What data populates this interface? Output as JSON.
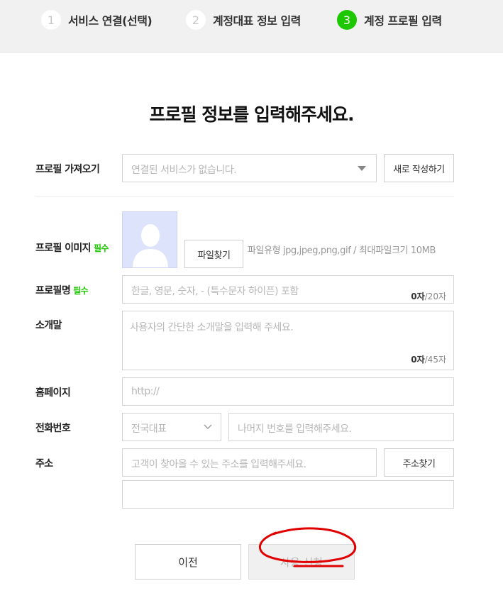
{
  "steps": [
    {
      "num": "1",
      "label": "서비스 연결(선택)"
    },
    {
      "num": "2",
      "label": "계정대표 정보 입력"
    },
    {
      "num": "3",
      "label": "계정 프로필 입력"
    }
  ],
  "page_title": "프로필 정보를 입력해주세요.",
  "colors": {
    "accent": "#1ec800",
    "annotation": "#e00000"
  },
  "profile_import": {
    "label": "프로필 가져오기",
    "select_placeholder": "연결된 서비스가 없습니다.",
    "new_button": "새로 작성하기"
  },
  "profile_image": {
    "label": "프로필 이미지",
    "required": "필수",
    "file_button": "파일찾기",
    "file_info": "파일유형 jpg,jpeg,png,gif / 최대파일크기 10MB"
  },
  "profile_name": {
    "label": "프로필명",
    "required": "필수",
    "placeholder": "한글, 영문, 숫자, - (특수문자 하이픈) 포함",
    "count": "0자",
    "max": "/20자"
  },
  "intro": {
    "label": "소개말",
    "placeholder": "사용자의 간단한 소개말을 입력해 주세요.",
    "count": "0자",
    "max": "/45자"
  },
  "homepage": {
    "label": "홈페이지",
    "placeholder": "http://"
  },
  "phone": {
    "label": "전화번호",
    "select_value": "전국대표",
    "placeholder": "나머지 번호를 입력해주세요."
  },
  "address": {
    "label": "주소",
    "placeholder": "고객이 찾아올 수 있는 주소를 입력해주세요.",
    "search_button": "주소찾기",
    "detail_placeholder": ""
  },
  "footer": {
    "prev_button": "이전",
    "submit_button": "사용 신청"
  }
}
